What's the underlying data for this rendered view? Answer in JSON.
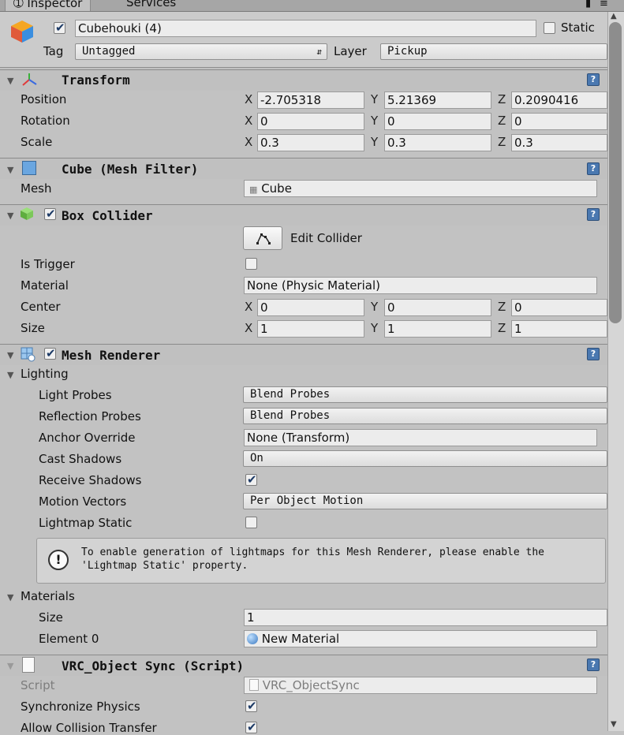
{
  "tabs": [
    {
      "label": "Inspector",
      "icon": "info-icon"
    },
    {
      "label": "Services"
    }
  ],
  "header": {
    "enabled": true,
    "name": "Cubehouki (4)",
    "static_label": "Static",
    "static_checked": false,
    "tag_label": "Tag",
    "tag_value": "Untagged",
    "layer_label": "Layer",
    "layer_value": "Pickup"
  },
  "transform": {
    "title": "Transform",
    "rows": [
      {
        "label": "Position",
        "x": "-2.705318",
        "y": "5.21369",
        "z": "0.2090416"
      },
      {
        "label": "Rotation",
        "x": "0",
        "y": "0",
        "z": "0"
      },
      {
        "label": "Scale",
        "x": "0.3",
        "y": "0.3",
        "z": "0.3"
      }
    ]
  },
  "mesh_filter": {
    "title": "Cube (Mesh Filter)",
    "mesh_label": "Mesh",
    "mesh_value": "Cube"
  },
  "box_collider": {
    "title": "Box Collider",
    "enabled": true,
    "edit_label": "Edit Collider",
    "is_trigger_label": "Is Trigger",
    "is_trigger": false,
    "material_label": "Material",
    "material_value": "None (Physic Material)",
    "center_label": "Center",
    "center": {
      "x": "0",
      "y": "0",
      "z": "0"
    },
    "size_label": "Size",
    "size": {
      "x": "1",
      "y": "1",
      "z": "1"
    }
  },
  "mesh_renderer": {
    "title": "Mesh Renderer",
    "enabled": true,
    "lighting_label": "Lighting",
    "light_probes_label": "Light Probes",
    "light_probes_value": "Blend Probes",
    "reflection_probes_label": "Reflection Probes",
    "reflection_probes_value": "Blend Probes",
    "anchor_override_label": "Anchor Override",
    "anchor_override_value": "None (Transform)",
    "cast_shadows_label": "Cast Shadows",
    "cast_shadows_value": "On",
    "receive_shadows_label": "Receive Shadows",
    "receive_shadows": true,
    "motion_vectors_label": "Motion Vectors",
    "motion_vectors_value": "Per Object Motion",
    "lightmap_static_label": "Lightmap Static",
    "lightmap_static": false,
    "info_text": "To enable generation of lightmaps for this Mesh Renderer, please enable the 'Lightmap Static' property.",
    "materials_label": "Materials",
    "size_label": "Size",
    "size_value": "1",
    "element0_label": "Element 0",
    "element0_value": "New Material"
  },
  "object_sync": {
    "title": "VRC_Object Sync (Script)",
    "script_label": "Script",
    "script_value": "VRC_ObjectSync",
    "sync_physics_label": "Synchronize Physics",
    "sync_physics": true,
    "allow_collision_label": "Allow Collision Transfer",
    "allow_collision": true
  },
  "axis_labels": {
    "x": "X",
    "y": "Y",
    "z": "Z"
  },
  "colors": {
    "accent": "#4a78b0",
    "panel": "#c2c2c2",
    "field": "#ececec"
  }
}
